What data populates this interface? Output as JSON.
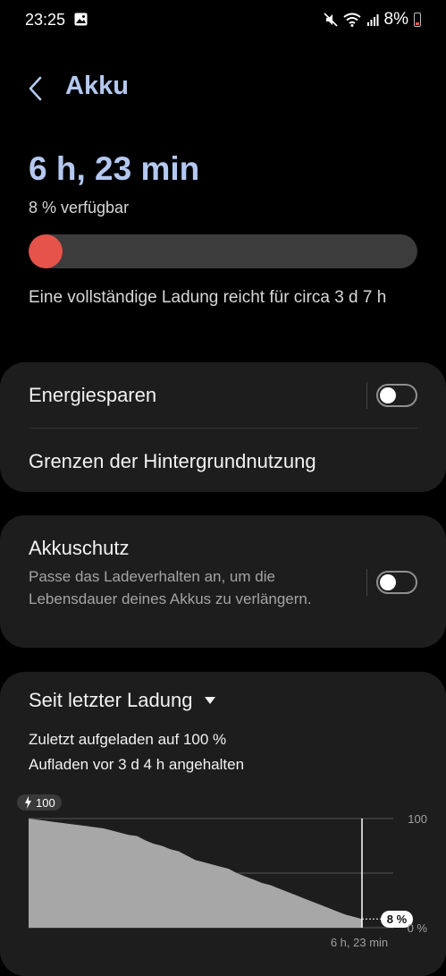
{
  "status_bar": {
    "time": "23:25",
    "battery_percent": "8%"
  },
  "header": {
    "back_icon": "chevron-left-icon",
    "title": "Akku"
  },
  "battery": {
    "remaining_time": "6 h, 23 min",
    "available": "8 % verfügbar",
    "level_fraction": 0.08,
    "bar_color": "#e5534b",
    "full_charge_text": "Eine vollständige Ladung reicht für circa 3 d 7 h"
  },
  "settings": {
    "energy_saving_label": "Energiesparen",
    "energy_saving_on": false,
    "background_limits_label": "Grenzen der Hintergrundnutzung",
    "protection_label": "Akkuschutz",
    "protection_description": "Passe das Ladeverhalten an, um die Lebensdauer deines Akkus zu verlängern.",
    "protection_on": false
  },
  "usage": {
    "period_label": "Seit letzter Ladung",
    "charged_to": "Zuletzt aufgeladen auf 100 %",
    "charging_stopped": "Aufladen vor 3 d 4 h angehalten"
  },
  "chart_data": {
    "type": "area",
    "start_badge": "100",
    "end_badge": "8 %",
    "y_tick_labels": [
      "100",
      "0 %"
    ],
    "x_label": "6 h, 23 min",
    "ylim": [
      0,
      100
    ],
    "values": [
      100,
      99,
      98,
      97,
      96,
      95,
      94,
      93,
      92,
      91,
      89,
      87,
      85,
      84,
      80,
      77,
      75,
      72,
      70,
      66,
      62,
      60,
      58,
      56,
      54,
      50,
      47,
      44,
      41,
      39,
      36,
      33,
      30,
      27,
      24,
      21,
      18,
      15,
      12,
      10,
      8
    ],
    "color_area": "#a7a7a7"
  }
}
